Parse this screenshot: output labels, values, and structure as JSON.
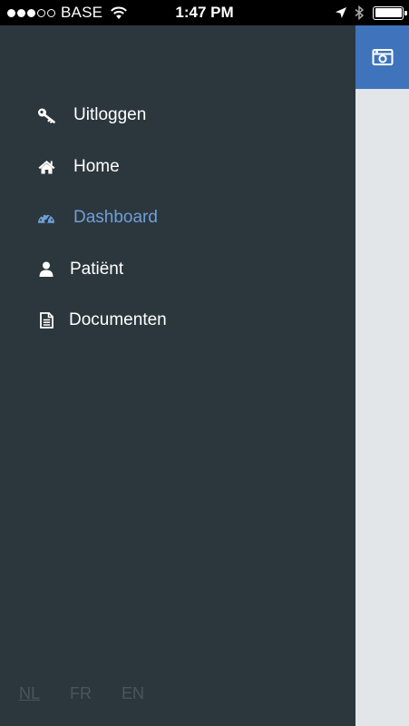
{
  "status_bar": {
    "carrier": "BASE",
    "time": "1:47 PM",
    "signal_bars_filled": 3,
    "signal_bars_total": 5
  },
  "drawer": {
    "menu": [
      {
        "label": "Uitloggen",
        "icon": "key-icon",
        "active": false
      },
      {
        "label": "Home",
        "icon": "home-icon",
        "active": false
      },
      {
        "label": "Dashboard",
        "icon": "dashboard-icon",
        "active": true
      },
      {
        "label": "Patiënt",
        "icon": "user-icon",
        "active": false
      },
      {
        "label": "Documenten",
        "icon": "document-icon",
        "active": false
      }
    ],
    "languages": [
      {
        "label": "NL",
        "selected": true
      },
      {
        "label": "FR",
        "selected": false
      },
      {
        "label": "EN",
        "selected": false
      }
    ]
  },
  "content": {
    "top_button_icon": "camera-icon"
  },
  "colors": {
    "drawer_bg": "#2c373d",
    "active_item": "#6f9fd8",
    "accent_button": "#3f74bc",
    "content_bg": "#e2e6e8",
    "language_text": "#4a555b"
  }
}
